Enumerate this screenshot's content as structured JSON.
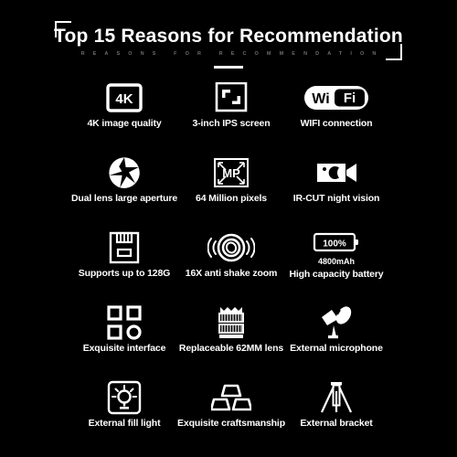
{
  "header": {
    "title": "Top 15 Reasons for Recommendation",
    "subtitle": "REASONS FOR RECOMMENDATION"
  },
  "colors": {
    "background": "#000000",
    "foreground": "#ffffff",
    "subtitle": "#6d6d6d"
  },
  "features": [
    {
      "icon": "4k-badge-icon",
      "label": "4K image quality",
      "icon_text": "4K"
    },
    {
      "icon": "screen-corners-icon",
      "label": "3-inch IPS screen"
    },
    {
      "icon": "wifi-logo-icon",
      "label": "WIFI connection",
      "icon_text_a": "Wi",
      "icon_text_b": "Fi"
    },
    {
      "icon": "aperture-icon",
      "label": "Dual lens large aperture"
    },
    {
      "icon": "megapixel-icon",
      "label": "64 Million pixels",
      "icon_text": "MP"
    },
    {
      "icon": "night-vision-camera-icon",
      "label": "IR-CUT night vision"
    },
    {
      "icon": "sd-card-icon",
      "label": "Supports up to 128G"
    },
    {
      "icon": "anti-shake-lens-icon",
      "label": "16X anti shake zoom"
    },
    {
      "icon": "battery-icon",
      "label": "High capacity battery",
      "icon_text": "100%",
      "sub_label": "4800mAh"
    },
    {
      "icon": "interface-grid-icon",
      "label": "Exquisite interface"
    },
    {
      "icon": "lens-barrel-icon",
      "label": "Replaceable 62MM lens"
    },
    {
      "icon": "microphone-icon",
      "label": "External microphone"
    },
    {
      "icon": "fill-light-icon",
      "label": "External fill light"
    },
    {
      "icon": "blocks-stack-icon",
      "label": "Exquisite craftsmanship"
    },
    {
      "icon": "tripod-icon",
      "label": "External bracket"
    }
  ]
}
